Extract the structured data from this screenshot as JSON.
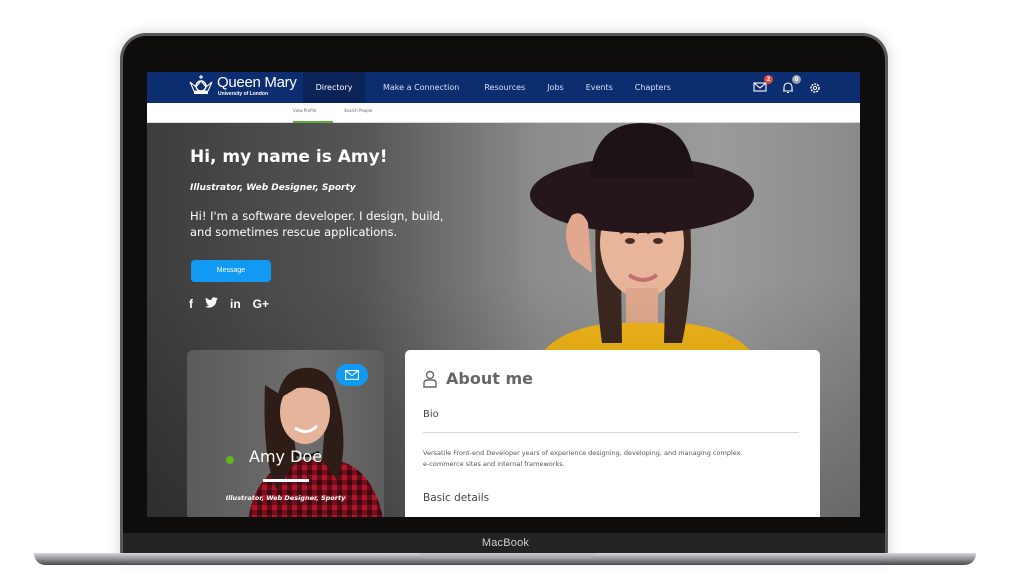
{
  "device": {
    "brand_label": "MacBook"
  },
  "navbar": {
    "logo": {
      "name": "Queen Mary",
      "subtitle": "University of London"
    },
    "items": [
      {
        "label": "Directory",
        "active": true
      },
      {
        "label": "Make a Connection",
        "active": false
      },
      {
        "label": "Resources",
        "active": false
      },
      {
        "label": "Jobs",
        "active": false
      },
      {
        "label": "Events",
        "active": false
      },
      {
        "label": "Chapters",
        "active": false
      }
    ],
    "icons": {
      "mail": {
        "name": "mail-icon",
        "badge": "2"
      },
      "bell": {
        "name": "bell-icon",
        "badge": "0"
      },
      "settings": {
        "name": "gear-icon"
      }
    }
  },
  "subtabs": [
    {
      "label": "View Profile",
      "active": true
    },
    {
      "label": "Search People",
      "active": false
    }
  ],
  "hero": {
    "title": "Hi, my name is Amy!",
    "tags": "Illustrator, Web Designer, Sporty",
    "description": "Hi! I'm a software developer. I design, build, and sometimes rescue applications.",
    "message_button": "Message",
    "socials": [
      {
        "name": "facebook-icon",
        "glyph": "f"
      },
      {
        "name": "twitter-icon",
        "glyph": "🐦"
      },
      {
        "name": "linkedin-icon",
        "glyph": "in"
      },
      {
        "name": "google-plus-icon",
        "glyph": "G+"
      }
    ]
  },
  "profile_card": {
    "name": "Amy Doe",
    "status": "online",
    "status_color": "#5cb81b",
    "tags": "Illustrator, Web Designer, Sporty"
  },
  "about": {
    "title": "About me",
    "bio_label": "Bio",
    "bio_text": "Versatile Front-end Developer years of experience designing, developing, and managing complex e-commerce sites and internal frameworks.",
    "basic_details_label": "Basic details"
  },
  "colors": {
    "navbar": "#0c2d6f",
    "navbar_active": "#0a2358",
    "accent": "#119af4",
    "tab_indicator": "#5aae33",
    "badge_red": "#e5463d"
  }
}
